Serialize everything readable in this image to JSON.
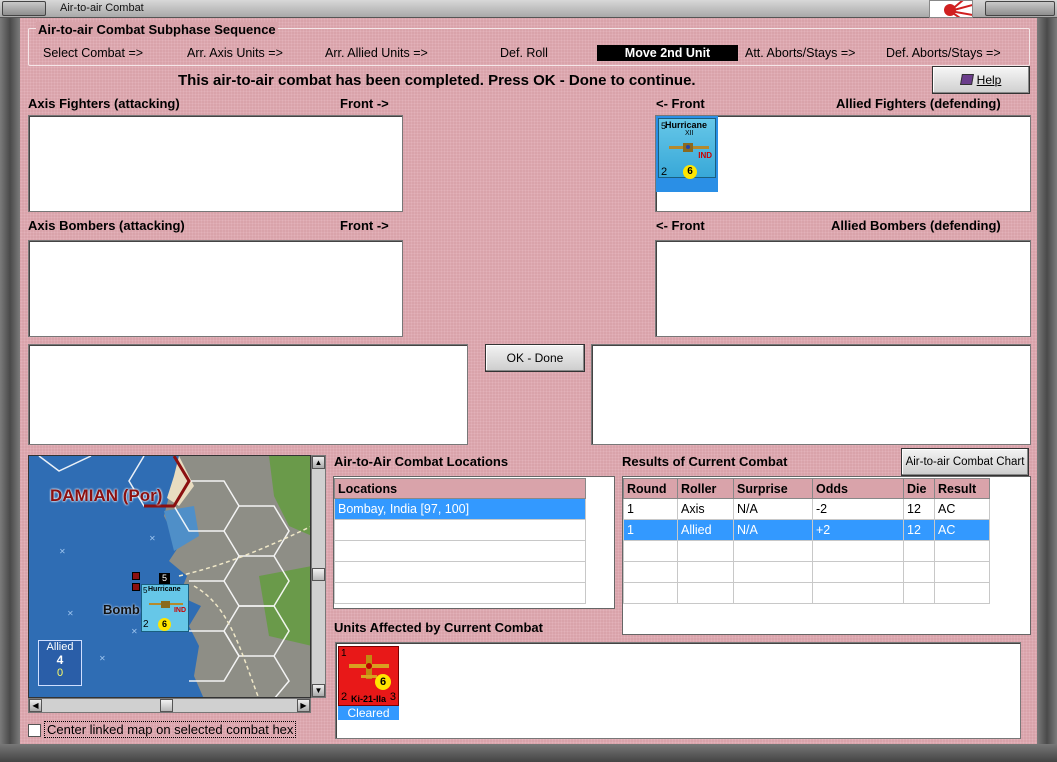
{
  "window": {
    "title": "Air-to-air Combat"
  },
  "sequence": {
    "title": "Air-to-air Combat Subphase Sequence",
    "steps": [
      "Select Combat =>",
      "Arr. Axis Units =>",
      "Arr. Allied Units =>",
      "Def. Roll",
      "Move 2nd Unit",
      "Att. Aborts/Stays =>",
      "Def. Aborts/Stays =>"
    ],
    "active_step": "Move 2nd Unit"
  },
  "status_message": "This air-to-air combat has been completed.  Press OK - Done to continue.",
  "help_label": "Help",
  "sections": {
    "axis_fighters": "Axis Fighters (attacking)",
    "axis_fighters_front": "Front ->",
    "allied_fighters_front": "<- Front",
    "allied_fighters": "Allied Fighters (defending)",
    "axis_bombers": "Axis Bombers (attacking)",
    "axis_bombers_front": "Front ->",
    "allied_bombers_front": "<- Front",
    "allied_bombers": "Allied Bombers (defending)"
  },
  "allied_fighter_unit": {
    "name": "Hurricane",
    "sub": "XII",
    "nationality": "IND",
    "top_left": "5",
    "bottom_left": "2",
    "die": "6"
  },
  "ok_button": "OK - Done",
  "map": {
    "label_damian": "DAMIAN (Por)",
    "label_bombay": "Bomb",
    "allied_label": "Allied",
    "allied_count": "4",
    "allied_zero": "0",
    "stack_count": "5",
    "unit_name": "Hurricane",
    "unit_nat": "IND",
    "unit_top": "5",
    "unit_bottom": "2",
    "unit_die": "6"
  },
  "center_map_checkbox": "Center linked map on selected combat hex",
  "locations": {
    "title": "Air-to-Air Combat Locations",
    "header": "Locations",
    "rows": [
      "Bombay, India [97, 100]",
      "",
      "",
      "",
      ""
    ]
  },
  "results": {
    "title": "Results of Current Combat",
    "chart_button": "Air-to-air Combat Chart",
    "headers": [
      "Round",
      "Roller",
      "Surprise",
      "Odds",
      "Die",
      "Result"
    ],
    "rows": [
      [
        "1",
        "Axis",
        "N/A",
        "-2",
        "12",
        "AC"
      ],
      [
        "1",
        "Allied",
        "N/A",
        "+2",
        "12",
        "AC"
      ],
      [
        "",
        "",
        "",
        "",
        "",
        ""
      ],
      [
        "",
        "",
        "",
        "",
        "",
        ""
      ],
      [
        "",
        "",
        "",
        "",
        "",
        ""
      ]
    ],
    "selected_row": 1
  },
  "affected": {
    "title": "Units Affected by Current Combat",
    "unit_name": "Ki-21-IIa",
    "unit_top": "1",
    "unit_bottom": "2",
    "unit_right": "3",
    "unit_die": "6",
    "unit_status": "Cleared"
  },
  "colors": {
    "panel_pink": "#d9a3aa",
    "selection_blue": "#3399ff",
    "allied_counter": "#66c7e8",
    "japanese_counter": "#e81818"
  }
}
